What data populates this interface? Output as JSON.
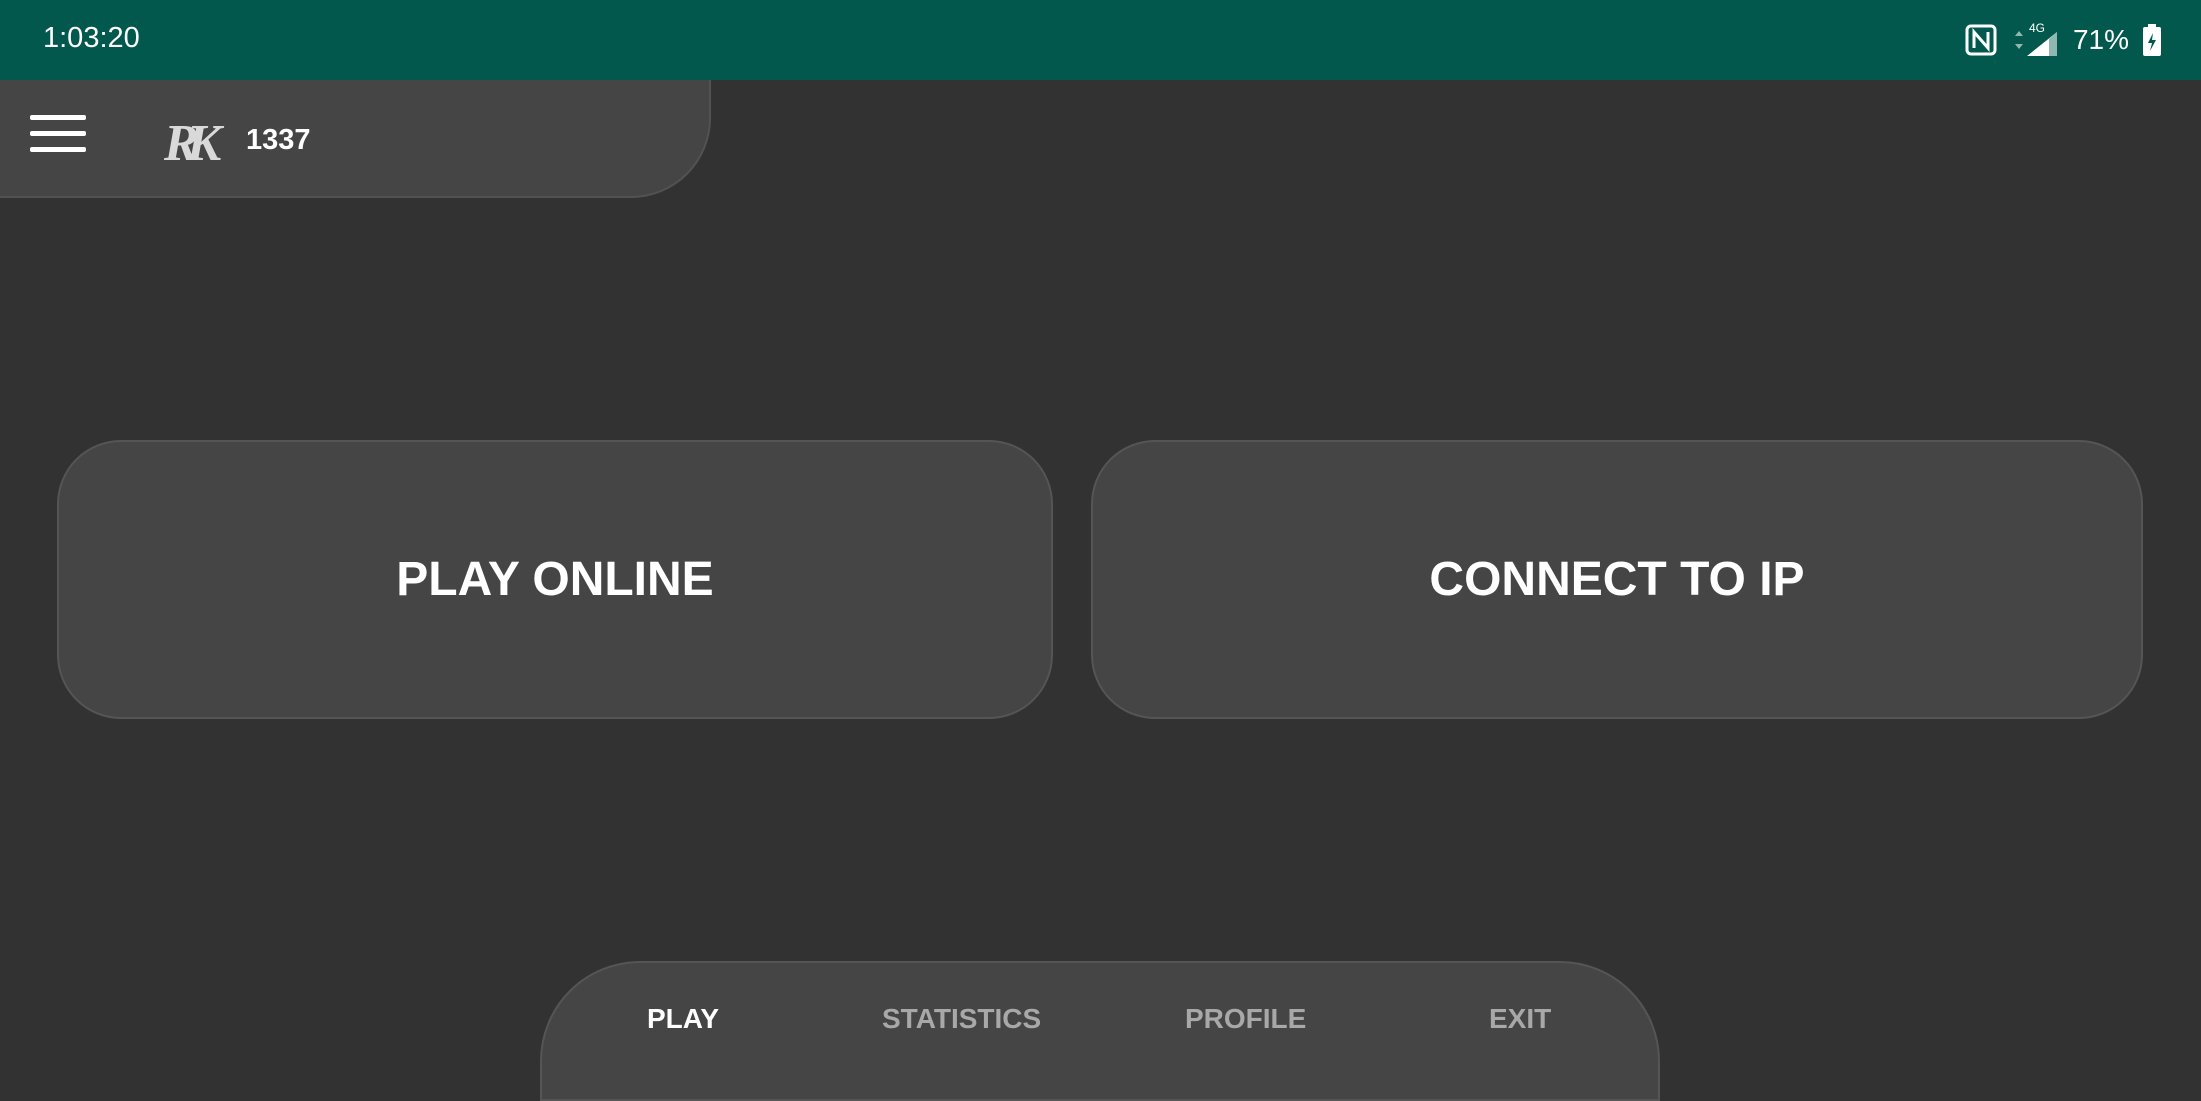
{
  "status_bar": {
    "time": "1:03:20",
    "network_type": "4G",
    "battery_percent": "71%",
    "icons": [
      "nfc-icon",
      "signal-icon",
      "battery-charging-icon"
    ],
    "background_color": "#02584c"
  },
  "header": {
    "logo_text": "RK",
    "score": "1337"
  },
  "main": {
    "play_online_label": "PLAY ONLINE",
    "connect_ip_label": "CONNECT TO IP"
  },
  "bottom_nav": {
    "active_tab": "PLAY",
    "tabs": [
      {
        "label": "PLAY"
      },
      {
        "label": "STATISTICS"
      },
      {
        "label": "PROFILE"
      },
      {
        "label": "EXIT"
      }
    ]
  },
  "colors": {
    "background": "#323232",
    "panel": "#454545",
    "accent_status": "#02584c",
    "text_primary": "#ffffff",
    "text_inactive": "#a8a8a8"
  }
}
